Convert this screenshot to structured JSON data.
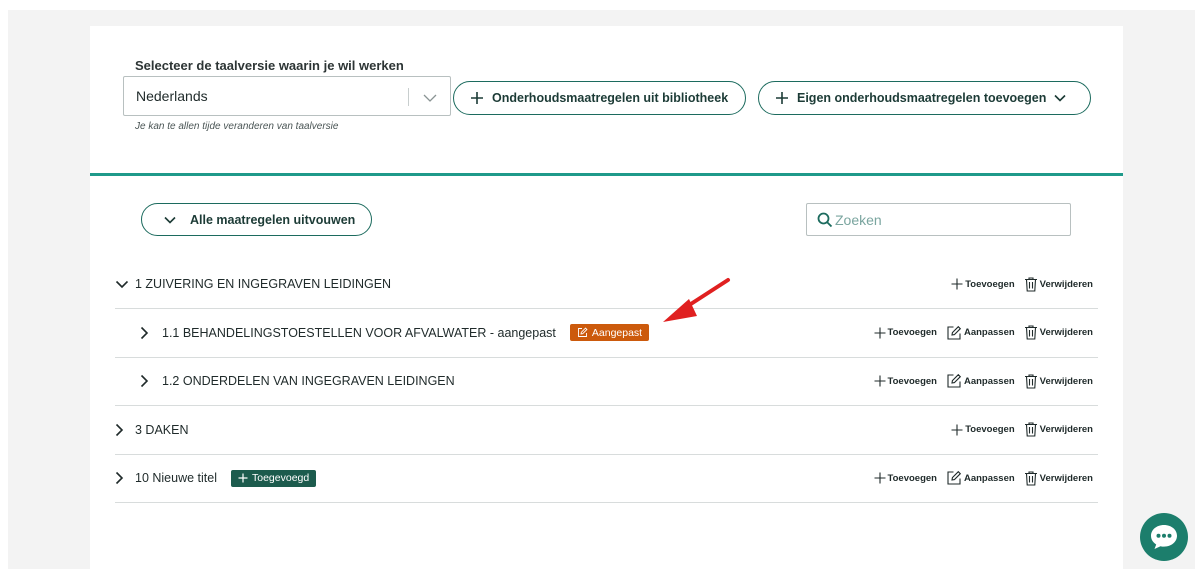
{
  "language": {
    "label": "Selecteer de taalversie waarin je wil werken",
    "selected": "Nederlands",
    "hint": "Je kan te allen tijde veranderen van taalversie"
  },
  "toolbar": {
    "library_label": "Onderhoudsmaatregelen uit bibliotheek",
    "own_label": "Eigen onderhoudsmaatregelen toevoegen"
  },
  "expand_all_label": "Alle maatregelen uitvouwen",
  "search": {
    "placeholder": "Zoeken"
  },
  "action_labels": {
    "add": "Toevoegen",
    "edit": "Aanpassen",
    "delete": "Verwijderen"
  },
  "tree": [
    {
      "title": "1 ZUIVERING EN INGEGRAVEN LEIDINGEN",
      "level": 1,
      "expanded": true,
      "badge": null
    },
    {
      "title": "1.1 BEHANDELINGSTOESTELLEN VOOR AFVALWATER - aangepast",
      "level": 2,
      "expanded": false,
      "badge": "Aangepast"
    },
    {
      "title": "1.2 ONDERDELEN VAN INGEGRAVEN LEIDINGEN",
      "level": 2,
      "expanded": false,
      "badge": null
    },
    {
      "title": "3 DAKEN",
      "level": 1,
      "expanded": false,
      "badge": null
    },
    {
      "title": "10 Nieuwe titel",
      "level": 1,
      "expanded": false,
      "badge": "Toegevoegd"
    }
  ],
  "colors": {
    "accent": "#1f9a8a",
    "primary_dark": "#1c6b5e",
    "badge_modified": "#cc5a0c",
    "badge_added": "#1c5b4d",
    "annotation_arrow": "#e02020",
    "chat_button": "#1c7e6c"
  },
  "icons": {
    "chat": "chat-bubble-icon",
    "search": "search-icon",
    "add": "plus-icon",
    "edit": "edit-icon",
    "delete": "trash-icon"
  }
}
